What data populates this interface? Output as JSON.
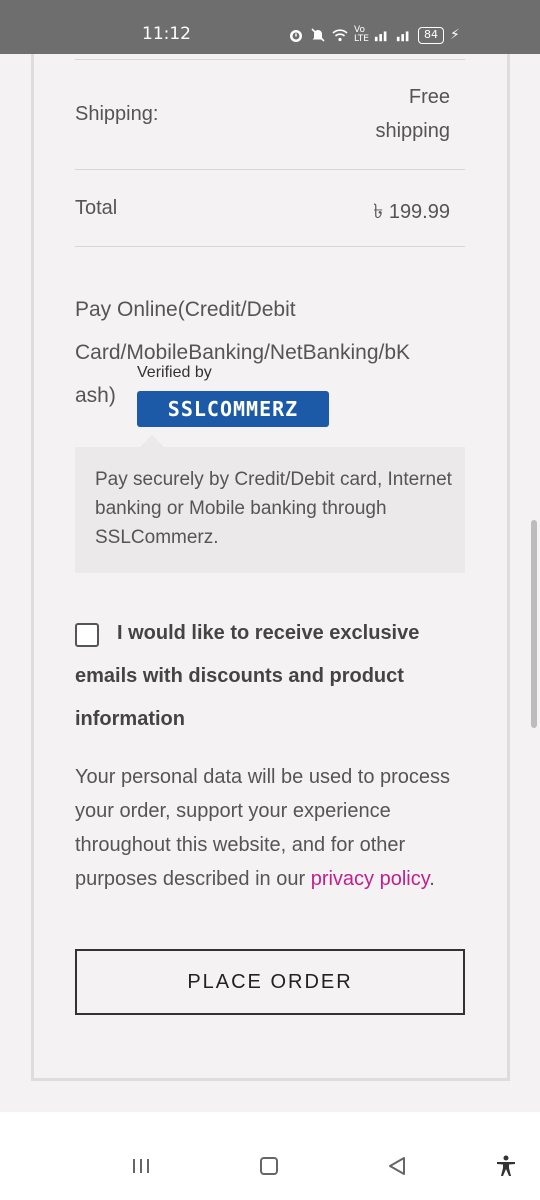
{
  "status_bar": {
    "time": "11:12",
    "volte": "Vo LTE",
    "battery": "84"
  },
  "order": {
    "shipping_label": "Shipping:",
    "shipping_value_line1": "Free",
    "shipping_value_line2": "shipping",
    "total_label": "Total",
    "total_value": "৳ 199.99"
  },
  "payment": {
    "method_title": "Pay Online(Credit/Debit Card/MobileBanking/NetBanking/bKash)",
    "method_title_line1": "Pay Online(Credit/Debit",
    "method_title_line2": "Card/MobileBanking/NetBanking/bK",
    "method_title_line3": "ash)",
    "verified_by": "Verified by",
    "logo_text": "SSLCOMMERZ",
    "description": "Pay securely by Credit/Debit card, Internet banking or Mobile banking through SSLCommerz."
  },
  "optin": {
    "label": "I would like to receive exclusive emails with discounts and product information",
    "checked": false
  },
  "privacy": {
    "text": "Your personal data will be used to process your order, support your experience throughout this website, and for other purposes described in our ",
    "link_text": "privacy policy",
    "after": "."
  },
  "place_order_label": "PLACE ORDER",
  "icons": {
    "recent_apps": "recent-apps-icon",
    "home": "home-icon",
    "back": "back-icon",
    "accessibility": "accessibility-icon"
  },
  "colors": {
    "link": "#c2208f",
    "ssl_blue": "#1c5aa8",
    "status_bar": "#6e6e6e"
  }
}
